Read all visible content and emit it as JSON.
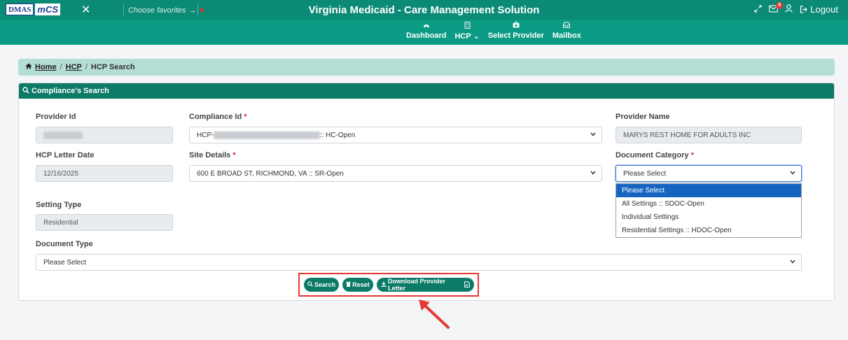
{
  "header": {
    "logo_dmas": "DMAS",
    "logo_mcs": "mCS",
    "favorites_label": "Choose favorites",
    "favorites_arrow": "→",
    "app_title": "Virginia Medicaid - Care Management Solution",
    "mail_badge": "0",
    "logout_label": "Logout"
  },
  "nav": {
    "items": [
      {
        "label": "Dashboard",
        "icon": "dashboard-icon"
      },
      {
        "label": "HCP",
        "icon": "building-icon",
        "dropdown": true
      },
      {
        "label": "Select Provider",
        "icon": "medical-case-icon"
      },
      {
        "label": "Mailbox",
        "icon": "inbox-icon"
      }
    ],
    "hcp_caret": "⌄"
  },
  "breadcrumb": {
    "home": "Home",
    "hcp": "HCP",
    "current": "HCP Search",
    "separator": "/"
  },
  "card": {
    "title": "Compliance's Search"
  },
  "form": {
    "provider_id": {
      "label": "Provider Id",
      "value": "0049409612"
    },
    "compliance_id": {
      "label": "Compliance Id",
      "value_prefix": "HCP-",
      "value_redacted": "0049409612-20251217-20251216",
      "value_suffix": " :: HC-Open"
    },
    "provider_name": {
      "label": "Provider Name",
      "value": "MARYS REST HOME FOR ADULTS INC"
    },
    "hcp_letter_date": {
      "label": "HCP Letter Date",
      "value": "12/16/2025"
    },
    "site_details": {
      "label": "Site Details",
      "value": "600 E BROAD ST, RICHMOND, VA :: SR-Open"
    },
    "document_category": {
      "label": "Document Category",
      "value": "Please Select",
      "options": [
        "Please Select",
        "All Settings :: SDOC-Open",
        "Individual Settings",
        "Residential Settings :: HDOC-Open"
      ]
    },
    "setting_type": {
      "label": "Setting Type",
      "value": "Residential"
    },
    "document_type": {
      "label": "Document Type",
      "value": "Please Select"
    },
    "required_mark": "*"
  },
  "buttons": {
    "search": "Search",
    "reset": "Reset",
    "download": "Download Provider Letter"
  },
  "colors": {
    "header": "#0b8a76",
    "nav": "#0b9a84",
    "card_header": "#0b7a67",
    "breadcrumb_bg": "#b4ddd6",
    "highlight": "#e53935"
  }
}
